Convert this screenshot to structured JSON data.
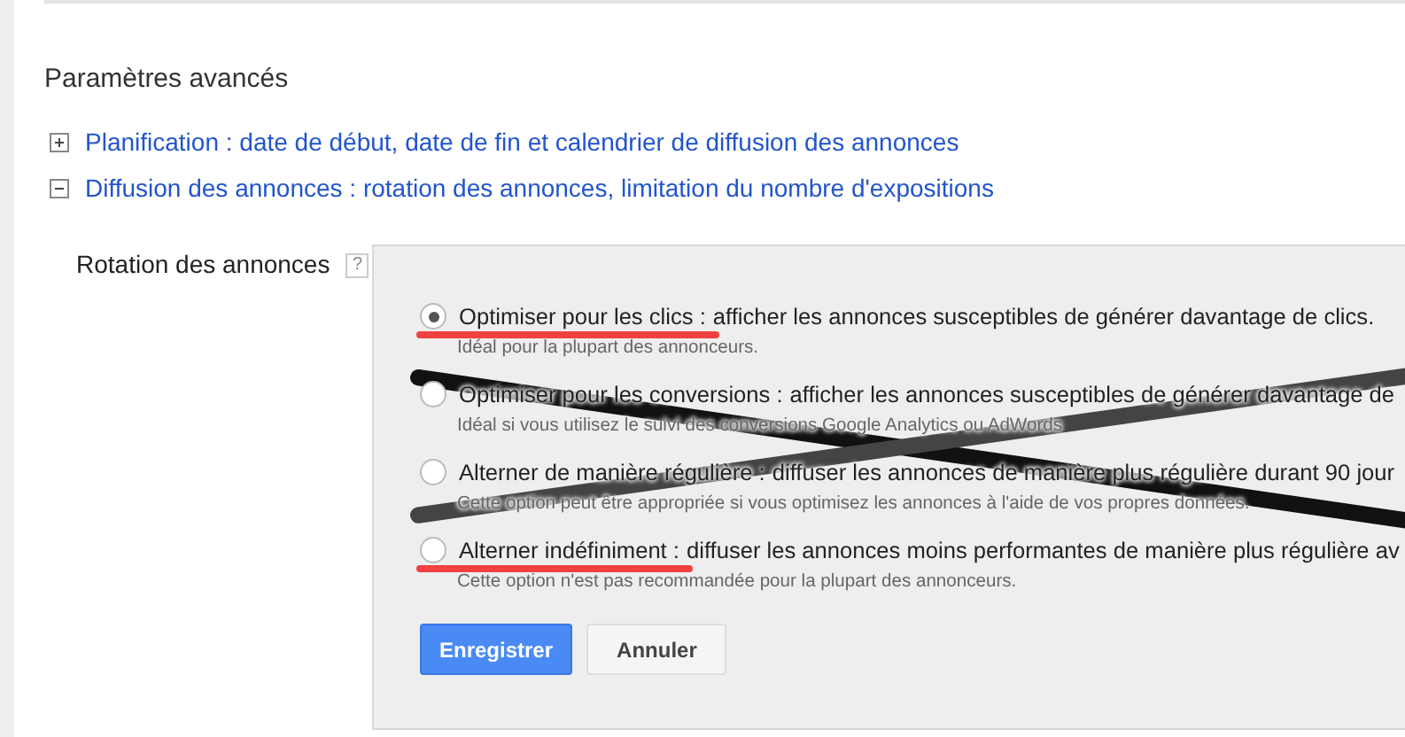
{
  "section_title": "Paramètres avancés",
  "settings_links": [
    {
      "label": "Planification : date de début, date de fin et calendrier de diffusion des annonces",
      "expanded": false
    },
    {
      "label": "Diffusion des annonces : rotation des annonces, limitation du nombre d'expositions",
      "expanded": true
    }
  ],
  "rotation": {
    "label": "Rotation des annonces",
    "help": "?",
    "options": [
      {
        "title": "Optimiser pour les clics :",
        "description": "afficher les annonces susceptibles de générer davantage de clics.",
        "hint": "Idéal pour la plupart des annonceurs.",
        "selected": true,
        "underlined": true,
        "crossed_out": false
      },
      {
        "title": "Optimiser pour les conversions :",
        "description": "afficher les annonces susceptibles de générer davantage de",
        "hint": "Idéal si vous utilisez le suivi des conversions Google Analytics ou AdWords",
        "selected": false,
        "underlined": false,
        "crossed_out": true
      },
      {
        "title": "Alterner de manière régulière :",
        "description": "diffuser les annonces de manière plus régulière durant 90 jour",
        "hint": "Cette option peut être appropriée si vous optimisez les annonces à l'aide de vos propres données.",
        "selected": false,
        "underlined": false,
        "crossed_out": true
      },
      {
        "title": "Alterner indéfiniment :",
        "description": "diffuser les annonces moins performantes de manière plus régulière av",
        "hint": "Cette option n'est pas recommandée pour la plupart des annonceurs.",
        "selected": false,
        "underlined": true,
        "crossed_out": false
      }
    ],
    "buttons": [
      {
        "label": "Enregistrer",
        "kind": "primary"
      },
      {
        "label": "Annuler",
        "kind": "secondary"
      }
    ]
  }
}
